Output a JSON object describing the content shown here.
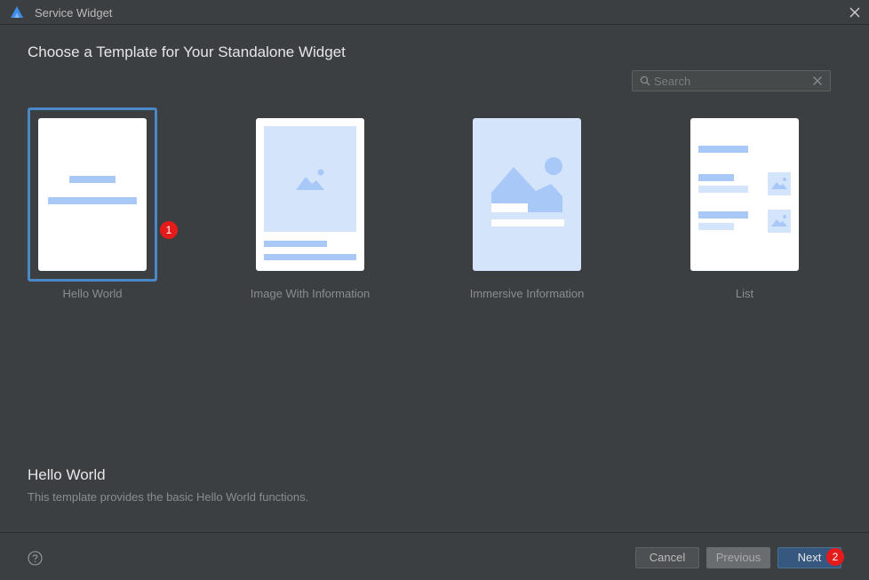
{
  "window": {
    "title": "Service Widget"
  },
  "heading": "Choose a Template for Your Standalone Widget",
  "search": {
    "placeholder": "Search",
    "value": ""
  },
  "templates": [
    {
      "label": "Hello World",
      "selected": true
    },
    {
      "label": "Image With Information",
      "selected": false
    },
    {
      "label": "Immersive Information",
      "selected": false
    },
    {
      "label": "List",
      "selected": false
    }
  ],
  "badges": {
    "template": "1",
    "next": "2"
  },
  "description": {
    "title": "Hello World",
    "text": "This template provides the basic Hello World functions."
  },
  "footer": {
    "cancel_label": "Cancel",
    "previous_label": "Previous",
    "next_label": "Next"
  },
  "colors": {
    "background": "#3c3f41",
    "selection_border": "#4a88c7",
    "preview_accent": "#a8c8f8",
    "preview_light": "#d4e4fb",
    "badge": "#e51a1a",
    "next_button": "#365880"
  },
  "icons": {
    "app": "app-logo-icon",
    "close": "close-icon",
    "search": "search-icon",
    "clear": "clear-icon",
    "help": "help-icon"
  }
}
